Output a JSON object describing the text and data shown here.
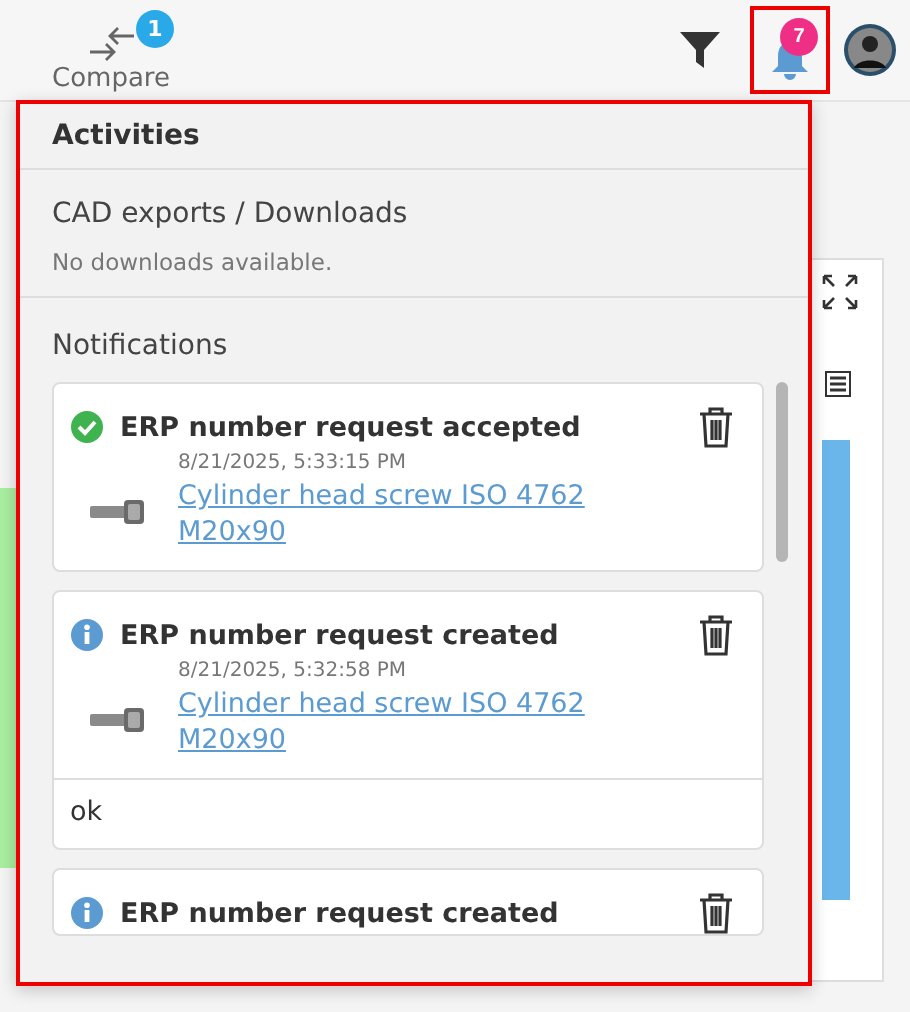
{
  "header": {
    "compare": {
      "label": "Compare",
      "badge": "1"
    },
    "notifications_badge": "7"
  },
  "activities": {
    "title": "Activities",
    "downloads": {
      "title": "CAD exports / Downloads",
      "empty_text": "No downloads available."
    },
    "notifications": {
      "title": "Notifications",
      "items": [
        {
          "kind": "success",
          "title": "ERP number request accepted",
          "date": "8/21/2025, 5:33:15 PM",
          "link": "Cylinder head screw ISO 4762 M20x90"
        },
        {
          "kind": "info",
          "title": "ERP number request created",
          "date": "8/21/2025, 5:32:58 PM",
          "link": "Cylinder head screw ISO 4762 M20x90",
          "comment": "ok"
        },
        {
          "kind": "info",
          "title": "ERP number request created"
        }
      ]
    }
  }
}
